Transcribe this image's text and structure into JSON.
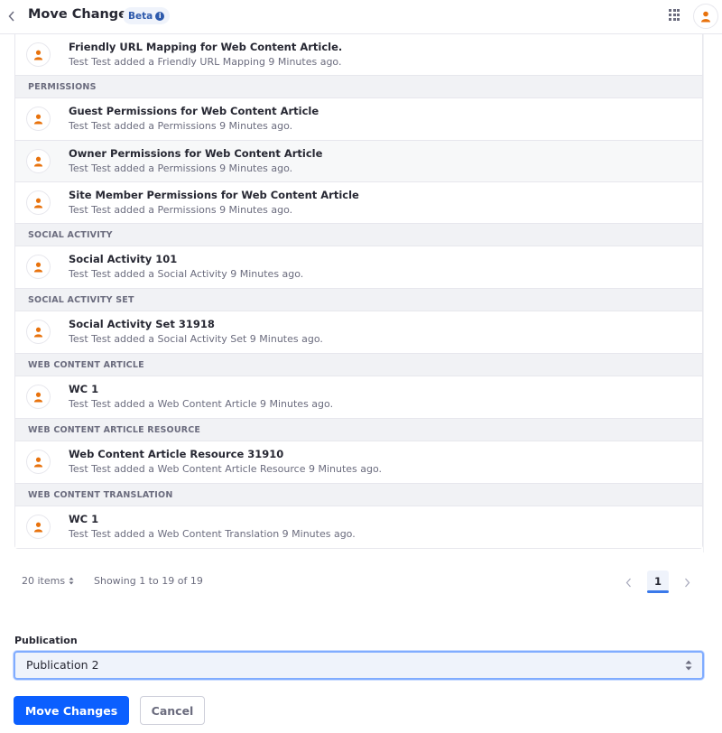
{
  "header": {
    "title": "Move Changes",
    "badge": "Beta",
    "back_icon": "chevron-left-icon",
    "info_icon": "info-circle-icon",
    "apps_icon": "grid-apps-icon",
    "user_icon": "user-avatar-icon"
  },
  "colors": {
    "accent": "#0b5fff",
    "avatar_icon": "#e8720c",
    "badge_text": "#2e5aac",
    "muted_text": "#6b6c7e",
    "group_bg": "#f1f2f5"
  },
  "list": {
    "first_row": {
      "title": "Friendly URL Mapping for Web Content Article.",
      "subtitle": "Test Test added a Friendly URL Mapping 9 Minutes ago."
    },
    "groups": [
      {
        "header": "PERMISSIONS",
        "rows": [
          {
            "title": "Guest Permissions for Web Content Article",
            "subtitle": "Test Test added a Permissions 9 Minutes ago."
          },
          {
            "title": "Owner Permissions for Web Content Article",
            "subtitle": "Test Test added a Permissions 9 Minutes ago."
          },
          {
            "title": "Site Member Permissions for Web Content Article",
            "subtitle": "Test Test added a Permissions 9 Minutes ago."
          }
        ]
      },
      {
        "header": "SOCIAL ACTIVITY",
        "rows": [
          {
            "title": "Social Activity 101",
            "subtitle": "Test Test added a Social Activity 9 Minutes ago."
          }
        ]
      },
      {
        "header": "SOCIAL ACTIVITY SET",
        "rows": [
          {
            "title": "Social Activity Set 31918",
            "subtitle": "Test Test added a Social Activity Set 9 Minutes ago."
          }
        ]
      },
      {
        "header": "WEB CONTENT ARTICLE",
        "rows": [
          {
            "title": "WC 1",
            "subtitle": "Test Test added a Web Content Article 9 Minutes ago."
          }
        ]
      },
      {
        "header": "WEB CONTENT ARTICLE RESOURCE",
        "rows": [
          {
            "title": "Web Content Article Resource 31910",
            "subtitle": "Test Test added a Web Content Article Resource 9 Minutes ago."
          }
        ]
      },
      {
        "header": "WEB CONTENT TRANSLATION",
        "rows": [
          {
            "title": "WC 1",
            "subtitle": "Test Test added a Web Content Translation 9 Minutes ago."
          }
        ]
      }
    ]
  },
  "pagination": {
    "items_per_page": "20 items",
    "showing": "Showing 1 to 19 of 19",
    "current_page": "1"
  },
  "form": {
    "publication_label": "Publication",
    "publication_value": "Publication 2",
    "submit_label": "Move Changes",
    "cancel_label": "Cancel"
  }
}
